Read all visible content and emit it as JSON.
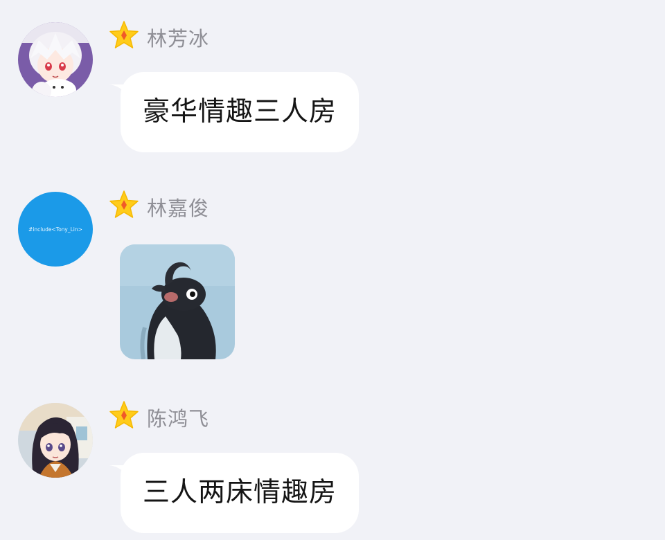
{
  "messages": [
    {
      "sender": "林芳冰",
      "type": "text",
      "text": "豪华情趣三人房",
      "avatar": "anime-white-hair-avatar",
      "badge_icon": "star-badge-icon"
    },
    {
      "sender": "林嘉俊",
      "type": "sticker",
      "sticker": "penguin-sticker",
      "avatar": "blue-text-avatar",
      "avatar_text": "#include<Tony_Lin>",
      "badge_icon": "star-badge-icon"
    },
    {
      "sender": "陈鸿飞",
      "type": "text",
      "text": "三人两床情趣房",
      "avatar": "anime-dark-hair-avatar",
      "badge_icon": "star-badge-icon"
    }
  ],
  "colors": {
    "background": "#f1f2f7",
    "bubble": "#ffffff",
    "name_text": "#8f8f96",
    "message_text": "#151515",
    "badge_star": "#ffcc1a",
    "badge_diamond": "#f05a28",
    "blue_avatar": "#1b9ae8"
  }
}
